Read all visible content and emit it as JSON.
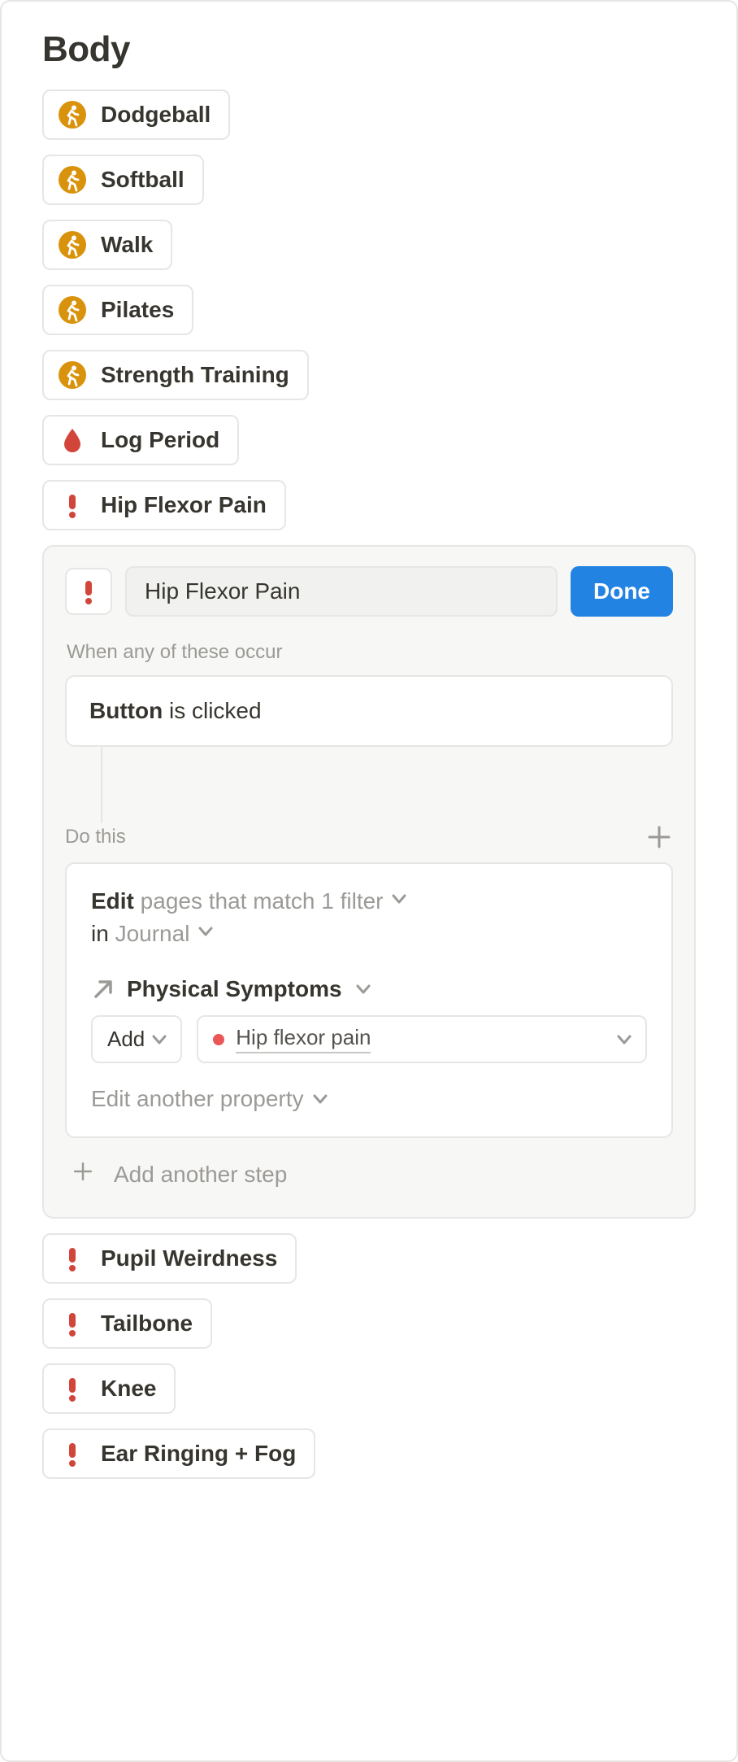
{
  "heading": "Body",
  "chips_top": [
    {
      "icon": "walk",
      "label": "Dodgeball"
    },
    {
      "icon": "walk",
      "label": "Softball"
    },
    {
      "icon": "walk",
      "label": "Walk"
    },
    {
      "icon": "walk",
      "label": "Pilates"
    },
    {
      "icon": "walk",
      "label": "Strength Training"
    },
    {
      "icon": "drop",
      "label": "Log Period"
    },
    {
      "icon": "alert",
      "label": "Hip Flexor Pain"
    }
  ],
  "automation": {
    "title_value": "Hip Flexor Pain",
    "done_label": "Done",
    "trigger_header": "When any of these occur",
    "trigger_bold": "Button",
    "trigger_rest": " is clicked",
    "dothis_label": "Do this",
    "action": {
      "edit_word": "Edit",
      "edit_rest": " pages that match 1 filter",
      "in_word": "in",
      "db_name": " Journal",
      "property_name": "Physical Symptoms",
      "add_label": "Add",
      "tag_value": "Hip flexor pain",
      "edit_another_label": "Edit another property"
    },
    "add_step_label": "Add another step"
  },
  "chips_bottom": [
    {
      "icon": "alert",
      "label": "Pupil Weirdness"
    },
    {
      "icon": "alert",
      "label": "Tailbone"
    },
    {
      "icon": "alert",
      "label": "Knee"
    },
    {
      "icon": "alert",
      "label": "Ear Ringing + Fog"
    }
  ]
}
